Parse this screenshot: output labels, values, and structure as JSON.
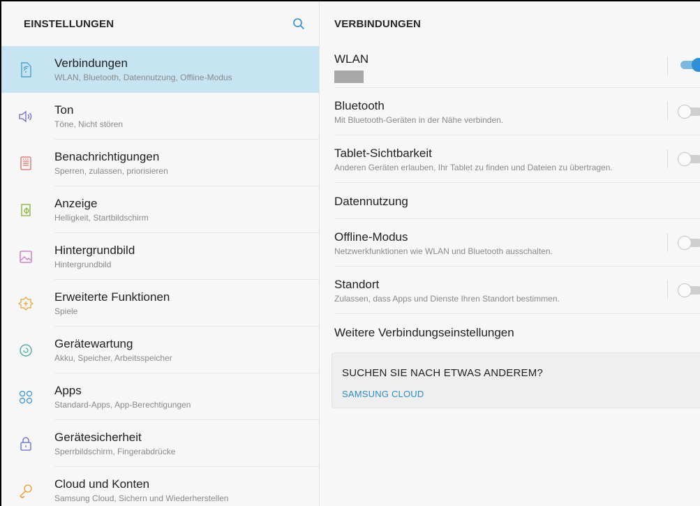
{
  "left": {
    "title": "EINSTELLUNGEN",
    "search_icon": "search-icon",
    "items": [
      {
        "label": "Verbindungen",
        "sub": "WLAN, Bluetooth, Datennutzung, Offline-Modus",
        "icon": "connections-icon",
        "active": true
      },
      {
        "label": "Ton",
        "sub": "Töne, Nicht stören",
        "icon": "sound-icon"
      },
      {
        "label": "Benachrichtigungen",
        "sub": "Sperren, zulassen, priorisieren",
        "icon": "notifications-icon"
      },
      {
        "label": "Anzeige",
        "sub": "Helligkeit, Startbildschirm",
        "icon": "display-icon"
      },
      {
        "label": "Hintergrundbild",
        "sub": "Hintergrundbild",
        "icon": "wallpaper-icon"
      },
      {
        "label": "Erweiterte Funktionen",
        "sub": "Spiele",
        "icon": "advanced-features-icon"
      },
      {
        "label": "Gerätewartung",
        "sub": "Akku, Speicher, Arbeitsspeicher",
        "icon": "device-maintenance-icon"
      },
      {
        "label": "Apps",
        "sub": "Standard-Apps, App-Berechtigungen",
        "icon": "apps-icon"
      },
      {
        "label": "Gerätesicherheit",
        "sub": "Sperrbildschirm, Fingerabdrücke",
        "icon": "lock-icon"
      },
      {
        "label": "Cloud und Konten",
        "sub": "Samsung Cloud, Sichern und Wiederherstellen",
        "icon": "key-icon"
      }
    ]
  },
  "right": {
    "title": "VERBINDUNGEN",
    "rows": [
      {
        "label": "WLAN",
        "sub": "",
        "toggle": true,
        "on": true
      },
      {
        "label": "Bluetooth",
        "sub": "Mit Bluetooth-Geräten in der Nähe verbinden.",
        "toggle": true,
        "on": false
      },
      {
        "label": "Tablet-Sichtbarkeit",
        "sub": "Anderen Geräten erlauben, Ihr Tablet zu finden und Dateien zu übertragen.",
        "toggle": true,
        "on": false
      },
      {
        "label": "Datennutzung",
        "sub": "",
        "toggle": false
      },
      {
        "label": "Offline-Modus",
        "sub": "Netzwerkfunktionen wie WLAN und Bluetooth ausschalten.",
        "toggle": true,
        "on": false
      },
      {
        "label": "Standort",
        "sub": "Zulassen, dass Apps und Dienste Ihren Standort bestimmen.",
        "toggle": true,
        "on": false
      },
      {
        "label": "Weitere Verbindungseinstellungen",
        "sub": "",
        "toggle": false
      }
    ],
    "suggestion": {
      "question": "SUCHEN SIE NACH ETWAS ANDEREM?",
      "link": "SAMSUNG CLOUD"
    }
  },
  "colors": {
    "accent": "#2e8fd6",
    "selected_bg": "#c6e4f1",
    "link": "#2b8ec8"
  }
}
